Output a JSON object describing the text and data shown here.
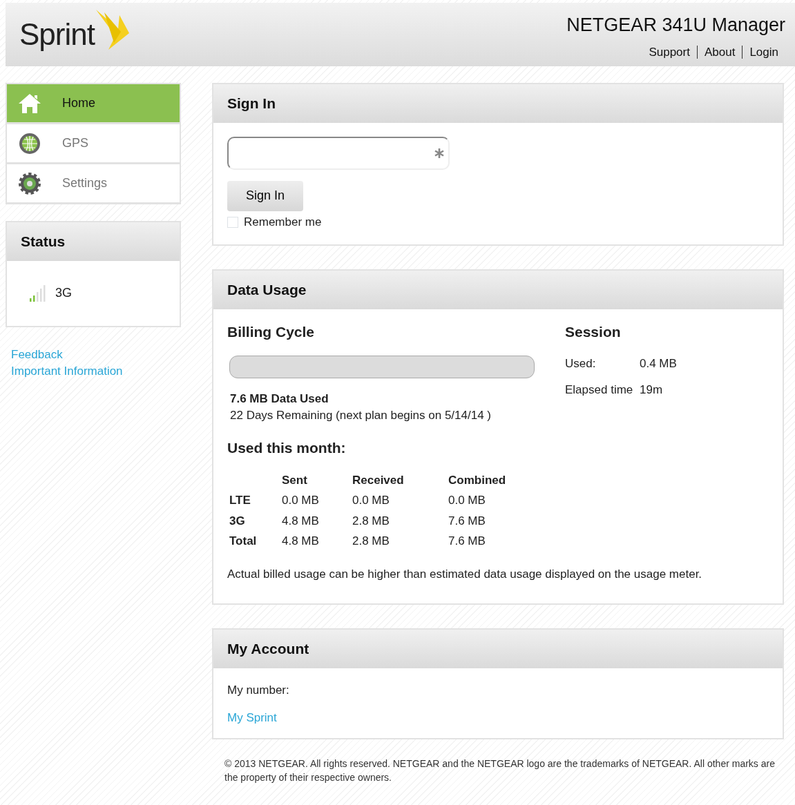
{
  "header": {
    "logo": "Sprint",
    "title": "NETGEAR 341U Manager",
    "links": [
      "Support",
      "About",
      "Login"
    ]
  },
  "nav": [
    {
      "label": "Home",
      "kind": "home",
      "selected": true
    },
    {
      "label": "GPS",
      "kind": "gps",
      "selected": false
    },
    {
      "label": "Settings",
      "kind": "settings",
      "selected": false
    }
  ],
  "status": {
    "title": "Status",
    "network": "3G"
  },
  "side_links": [
    "Feedback",
    "Important Information"
  ],
  "sign_in": {
    "title": "Sign In",
    "button": "Sign In",
    "remember": {
      "label": "Remember me",
      "checked": false
    }
  },
  "data_usage": {
    "title": "Data Usage",
    "billing_title": "Billing Cycle",
    "used": "7.6 MB Data Used",
    "remaining": "22 Days Remaining (next plan begins on 5/14/14 )",
    "session_title": "Session",
    "session": [
      {
        "label": "Used:",
        "value": "0.4 MB"
      },
      {
        "label": "Elapsed time",
        "value": "19m"
      }
    ],
    "month_title": "Used this month:",
    "columns": [
      "Sent",
      "Received",
      "Combined"
    ],
    "rows": [
      {
        "label": "LTE",
        "values": [
          "0.0 MB",
          "0.0 MB",
          "0.0 MB"
        ]
      },
      {
        "label": "3G",
        "values": [
          "4.8 MB",
          "2.8 MB",
          "7.6 MB"
        ]
      },
      {
        "label": "Total",
        "values": [
          "4.8 MB",
          "2.8 MB",
          "7.6 MB"
        ]
      }
    ],
    "note": "Actual billed usage can be higher than estimated data usage displayed on the usage meter."
  },
  "account": {
    "title": "My Account",
    "number_label": "My number:",
    "link": "My Sprint"
  },
  "footer": "© 2013 NETGEAR. All rights reserved. NETGEAR and the NETGEAR logo are the trademarks of NETGEAR. All other marks are the property of their respective owners."
}
